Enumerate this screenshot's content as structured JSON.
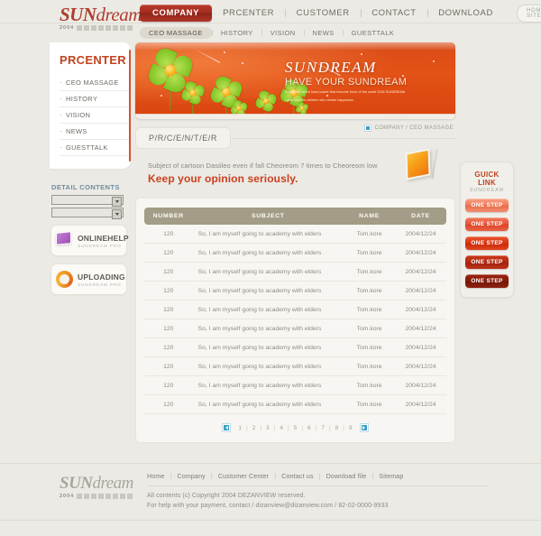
{
  "brand": {
    "name_part1": "SUN",
    "name_part2": "dream",
    "year": "2004",
    "sub_blocks": "P R O J E C T"
  },
  "mainnav": {
    "items": [
      {
        "label": "COMPANY",
        "active": true
      },
      {
        "label": "PRCENTER",
        "active": false
      },
      {
        "label": "CUSTOMER",
        "active": false
      },
      {
        "label": "CONTACT",
        "active": false
      },
      {
        "label": "DOWNLOAD",
        "active": false
      }
    ],
    "home_sitemap": "HOME / SITEMAP"
  },
  "subnav": {
    "items": [
      {
        "label": "CEO MASSAGE",
        "active": true
      },
      {
        "label": "HISTORY",
        "active": false
      },
      {
        "label": "VISION",
        "active": false
      },
      {
        "label": "NEWS",
        "active": false
      },
      {
        "label": "GUESTTALK",
        "active": false
      }
    ]
  },
  "sidebar": {
    "title": "PRCENTER",
    "items": [
      {
        "label": "CEO MASSAGE"
      },
      {
        "label": "HISTORY"
      },
      {
        "label": "VISION"
      },
      {
        "label": "NEWS"
      },
      {
        "label": "GUESTTALK"
      }
    ],
    "detail_contents_label": "DETAIL CONTENTS",
    "select_one_value": "",
    "select_two_value": "",
    "promos": [
      {
        "icon": "monitor-icon",
        "title": "ONLINEHELP",
        "subtitle": "SUNDREAM PRO"
      },
      {
        "icon": "upload-circle-icon",
        "title": "UPLOADING",
        "subtitle": "SUNDREAM PRO"
      }
    ]
  },
  "banner": {
    "headline": "SUNDREAM",
    "subhead": "HAVE YOUR SUNDREAM",
    "body_line1": "Enterprise which have power that become force of the world 2004 SUNDREAM",
    "body_line2": "I give hope to children who dream happiness."
  },
  "content": {
    "breadcrumb": "COMPANY / CEO MASSAGE",
    "tab_label": "P/R/C/E/N/T/E/R",
    "intro_line1": "Subject of cartoon Dasiileo even if fall Cheoreom 7 times to Cheoreom low",
    "intro_line2": "Keep your opinion seriously."
  },
  "table": {
    "headers": [
      "NUMBER",
      "SUBJECT",
      "NAME",
      "DATE"
    ],
    "rows": [
      {
        "number": "120",
        "subject": "So, I am myself going to academy with elders",
        "name": "Tom.kore",
        "date": "2004/12/24"
      },
      {
        "number": "120",
        "subject": "So, I am myself going to academy with elders",
        "name": "Tom.kore",
        "date": "2004/12/24"
      },
      {
        "number": "120",
        "subject": "So, I am myself going to academy with elders",
        "name": "Tom.kore",
        "date": "2004/12/24"
      },
      {
        "number": "120",
        "subject": "So, I am myself going to academy with elders",
        "name": "Tom.kore",
        "date": "2004/12/24"
      },
      {
        "number": "120",
        "subject": "So, I am myself going to academy with elders",
        "name": "Tom.kore",
        "date": "2004/12/24"
      },
      {
        "number": "120",
        "subject": "So, I am myself going to academy with elders",
        "name": "Tom.kore",
        "date": "2004/12/24"
      },
      {
        "number": "120",
        "subject": "So, I am myself going to academy with elders",
        "name": "Tom.kore",
        "date": "2004/12/24"
      },
      {
        "number": "120",
        "subject": "So, I am myself going to academy with elders",
        "name": "Tom.kore",
        "date": "2004/12/24"
      },
      {
        "number": "120",
        "subject": "So, I am myself going to academy with elders",
        "name": "Tom.kore",
        "date": "2004/12/24"
      },
      {
        "number": "120",
        "subject": "So, I am myself going to academy with elders",
        "name": "Tom.kore",
        "date": "2004/12/24"
      }
    ]
  },
  "pagination": {
    "prev_icon": "prev-arrow-icon",
    "next_icon": "next-arrow-icon",
    "pages": [
      "1",
      "2",
      "3",
      "4",
      "5",
      "6",
      "7",
      "8",
      "9"
    ]
  },
  "quicklink": {
    "title": "GUICK LINK",
    "subtitle": "SUNDREAM",
    "buttons": [
      {
        "label": "ONE STEP",
        "color": "#f08060"
      },
      {
        "label": "ONE STEP",
        "color": "#e8553a"
      },
      {
        "label": "ONE STEP",
        "color": "#d93511"
      },
      {
        "label": "ONE STEP",
        "color": "#b92a12"
      },
      {
        "label": "ONE STEP",
        "color": "#8e1d0c"
      }
    ]
  },
  "footer": {
    "links": [
      "Home",
      "Company",
      "Customer Center",
      "Contact us",
      "Download file",
      "Sitemap"
    ],
    "copyright": "All contents (c) Copyright 2004 DEZANVIEW reserved.",
    "contact": "For help with your payment, contact / dizanview@dizanview.com / 82-02-0000-9933"
  },
  "colors": {
    "accent_red": "#c0431f",
    "banner_orange": "#d9450f",
    "table_header": "#a39c86",
    "link_blue": "#3f9ec4"
  }
}
